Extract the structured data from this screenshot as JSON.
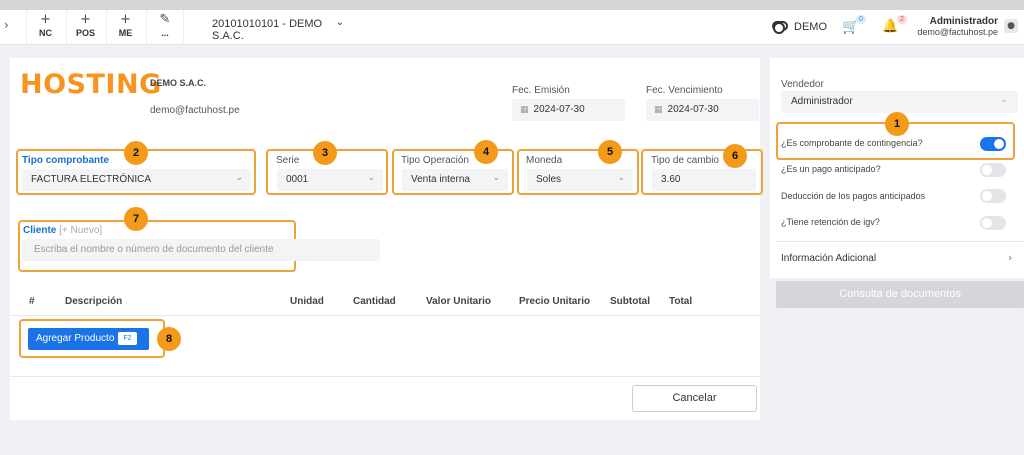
{
  "topbar": {
    "buttons": [
      {
        "icon": "+",
        "label": "NC"
      },
      {
        "icon": "+",
        "label": "POS"
      },
      {
        "icon": "+",
        "label": "ME"
      },
      {
        "icon": "pencil",
        "label": "..."
      }
    ],
    "company": "20101010101 - DEMO S.A.C.",
    "mode": "DEMO",
    "cart_count": "0",
    "notif_count": "2",
    "user_name": "Administrador",
    "user_email": "demo@factuhost.pe"
  },
  "header": {
    "logo_text": "HOSTING",
    "company_name": "DEMO S.A.C.",
    "company_email": "demo@factuhost.pe",
    "fec_emision_label": "Fec. Emisión",
    "fec_emision": "2024-07-30",
    "fec_vencimiento_label": "Fec. Vencimiento",
    "fec_vencimiento": "2024-07-30"
  },
  "form": {
    "tipo_comprobante_label": "Tipo comprobante",
    "tipo_comprobante": "FACTURA ELECTRÓNICA",
    "serie_label": "Serie",
    "serie": "0001",
    "tipo_operacion_label": "Tipo Operación",
    "tipo_operacion": "Venta interna",
    "moneda_label": "Moneda",
    "moneda": "Soles",
    "tipo_cambio_label": "Tipo de cambio",
    "tipo_cambio": "3.60",
    "cliente_label": "Cliente",
    "cliente_nuevo": "[+ Nuevo]",
    "cliente_placeholder": "Escriba el nombre o número de documento del cliente"
  },
  "table": {
    "headers": [
      "#",
      "Descripción",
      "Unidad",
      "Cantidad",
      "Valor Unitario",
      "Precio Unitario",
      "Subtotal",
      "Total"
    ]
  },
  "actions": {
    "add_product": "Agregar Producto",
    "add_product_key": "F2",
    "cancel": "Cancelar"
  },
  "sidebar": {
    "vendedor_label": "Vendedor",
    "vendedor": "Administrador",
    "options": [
      {
        "label": "¿Es comprobante de contingencia?",
        "on": true
      },
      {
        "label": "¿Es un pago anticipado?",
        "on": false
      },
      {
        "label": "Deducción de los pagos anticipados",
        "on": false
      },
      {
        "label": "¿Tiene retención de igv?",
        "on": false
      }
    ],
    "info_adicional": "Información Adicional",
    "consulta": "Consulta de documentos"
  },
  "callouts": [
    "1",
    "2",
    "3",
    "4",
    "5",
    "6",
    "7",
    "8"
  ],
  "colors": {
    "accent": "#1a73e8",
    "callout": "#f49a1a",
    "logo": "#f7931e"
  }
}
